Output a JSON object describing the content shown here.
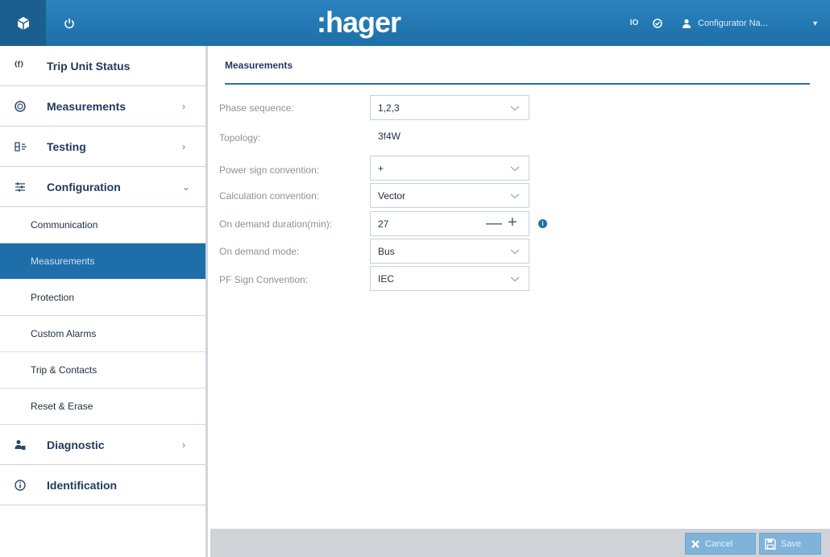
{
  "header": {
    "logo": ":hager",
    "io_label": "IO",
    "user_label": "Configurator Na..."
  },
  "sidebar": {
    "main_items": [
      {
        "label": "Trip Unit Status",
        "icon": "trip-unit-status-icon",
        "chevron": ""
      },
      {
        "label": "Measurements",
        "icon": "gauge-icon",
        "chevron": "›"
      },
      {
        "label": "Testing",
        "icon": "testing-icon",
        "chevron": "›"
      },
      {
        "label": "Configuration",
        "icon": "sliders-icon",
        "chevron": "⌄"
      },
      {
        "label": "Diagnostic",
        "icon": "diagnostic-icon",
        "chevron": "›"
      },
      {
        "label": "Identification",
        "icon": "info-circle-icon",
        "chevron": ""
      }
    ],
    "sub_items": [
      {
        "label": "Communication"
      },
      {
        "label": "Measurements",
        "active": true
      },
      {
        "label": "Protection"
      },
      {
        "label": "Custom Alarms"
      },
      {
        "label": "Trip & Contacts"
      },
      {
        "label": "Reset & Erase"
      }
    ]
  },
  "main": {
    "title": "Measurements",
    "rows": [
      {
        "label": "Phase sequence:",
        "value": "1,2,3",
        "type": "dropdown"
      },
      {
        "label": "Topology:",
        "value": "3f4W",
        "type": "text"
      },
      {
        "label": "Power sign convention:",
        "value": "+",
        "type": "dropdown"
      },
      {
        "label": "Calculation convention:",
        "value": "Vector",
        "type": "dropdown"
      },
      {
        "label": "On demand duration(min):",
        "value": "27",
        "type": "stepper"
      },
      {
        "label": "On demand mode:",
        "value": "Bus",
        "type": "dropdown"
      },
      {
        "label": "PF Sign Convention:",
        "value": "IEC",
        "type": "dropdown"
      }
    ]
  },
  "footer": {
    "cancel_label": "Cancel",
    "save_label": "Save"
  },
  "colors": {
    "header": "#2378b5",
    "active_nav": "#1e6fa9",
    "footer": "#cfd2d6"
  }
}
